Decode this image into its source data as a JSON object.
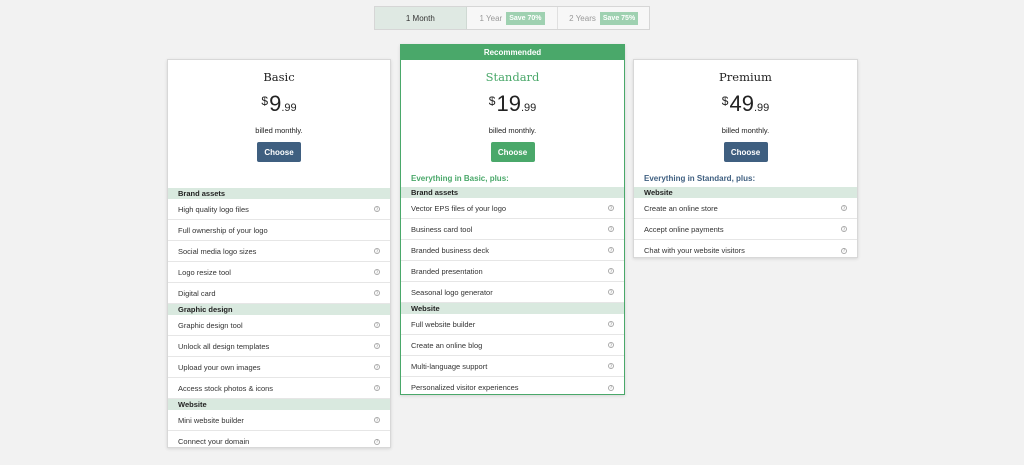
{
  "toggle": {
    "options": [
      {
        "label": "1 Month",
        "save": ""
      },
      {
        "label": "1 Year",
        "save": "Save 70%"
      },
      {
        "label": "2 Years",
        "save": "Save 75%"
      }
    ]
  },
  "plans": {
    "basic": {
      "name": "Basic",
      "currency": "$",
      "price_int": "9",
      "price_dec": ".99",
      "billed": "billed monthly.",
      "button": "Choose",
      "sections": [
        {
          "title": "Brand assets",
          "items": [
            "High quality logo files",
            "Full ownership of your logo",
            "Social media logo sizes",
            "Logo resize tool",
            "Digital card"
          ]
        },
        {
          "title": "Graphic design",
          "items": [
            "Graphic design tool",
            "Unlock all design templates",
            "Upload your own images",
            "Access stock photos & icons"
          ]
        },
        {
          "title": "Website",
          "items": [
            "Mini website builder",
            "Connect your domain"
          ]
        }
      ]
    },
    "standard": {
      "banner": "Recommended",
      "name": "Standard",
      "currency": "$",
      "price_int": "19",
      "price_dec": ".99",
      "billed": "billed monthly.",
      "button": "Choose",
      "everything": "Everything in Basic, plus:",
      "sections": [
        {
          "title": "Brand assets",
          "items": [
            "Vector EPS files of your logo",
            "Business card tool",
            "Branded business deck",
            "Branded presentation",
            "Seasonal logo generator"
          ]
        },
        {
          "title": "Website",
          "items": [
            "Full website builder",
            "Create an online blog",
            "Multi-language support",
            "Personalized visitor experiences"
          ]
        }
      ]
    },
    "premium": {
      "name": "Premium",
      "currency": "$",
      "price_int": "49",
      "price_dec": ".99",
      "billed": "billed monthly.",
      "button": "Choose",
      "everything": "Everything in Standard, plus:",
      "sections": [
        {
          "title": "Website",
          "items": [
            "Create an online store",
            "Accept online payments",
            "Chat with your website visitors"
          ]
        }
      ]
    }
  },
  "icons": {
    "info": "info-icon"
  },
  "colors": {
    "green": "#4aa86a",
    "blue": "#3f5f80",
    "section_bg": "#d9e9df"
  }
}
